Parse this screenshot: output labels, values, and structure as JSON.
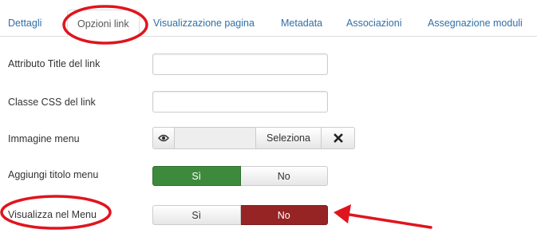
{
  "tabs": [
    {
      "label": "Dettagli",
      "active": false
    },
    {
      "label": "Opzioni link",
      "active": true
    },
    {
      "label": "Visualizzazione pagina",
      "active": false
    },
    {
      "label": "Metadata",
      "active": false
    },
    {
      "label": "Associazioni",
      "active": false
    },
    {
      "label": "Assegnazione moduli",
      "active": false
    }
  ],
  "fields": {
    "link_title": {
      "label": "Attributo Title del link",
      "value": ""
    },
    "link_css": {
      "label": "Classe CSS del link",
      "value": ""
    },
    "menu_image": {
      "label": "Immagine menu",
      "value": "",
      "select_label": "Seleziona",
      "preview_icon": "eye-icon",
      "clear_icon": "close-icon"
    },
    "add_title": {
      "label": "Aggiungi titolo menu",
      "options": [
        "Sì",
        "No"
      ],
      "selected": "Sì"
    },
    "show_in_menu": {
      "label": "Visualizza nel Menu",
      "options": [
        "Sì",
        "No"
      ],
      "selected": "No"
    }
  },
  "colors": {
    "tab_link": "#2f6fa7",
    "toggle_yes": "#3e8a3c",
    "toggle_no": "#962424",
    "annotation": "#e0141e"
  }
}
